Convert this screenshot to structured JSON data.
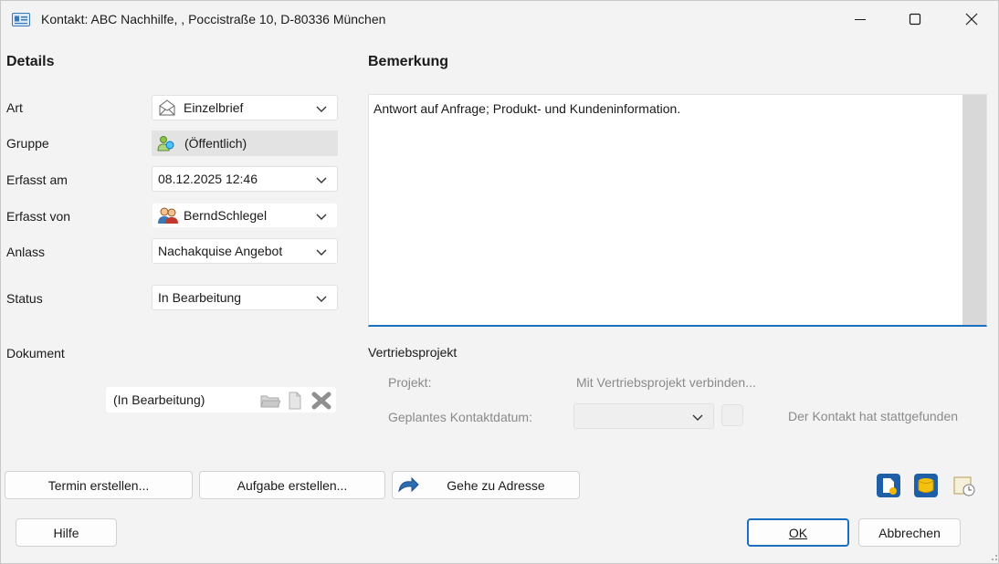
{
  "window": {
    "title": "Kontakt: ABC Nachhilfe,  , Poccistraße 10, D-80336 München",
    "minimize_glyph": "—",
    "close_glyph": "✕"
  },
  "details": {
    "heading": "Details",
    "fields": {
      "art": {
        "label": "Art",
        "value": "Einzelbrief",
        "icon": "envelope-icon"
      },
      "gruppe": {
        "label": "Gruppe",
        "value": "(Öffentlich)",
        "icon": "public-group-icon"
      },
      "erfasst_am": {
        "label": "Erfasst am",
        "value": "08.12.2025 12:46"
      },
      "erfasst_von": {
        "label": "Erfasst von",
        "value": "BerndSchlegel",
        "icon": "users-icon"
      },
      "anlass": {
        "label": "Anlass",
        "value": "Nachakquise Angebot"
      },
      "status": {
        "label": "Status",
        "value": "In Bearbeitung"
      }
    },
    "dokument": {
      "label": "Dokument",
      "value": "(In Bearbeitung)"
    }
  },
  "bemerkung": {
    "heading": "Bemerkung",
    "text": "Antwort auf Anfrage; Produkt- und Kundeninformation."
  },
  "vertriebsprojekt": {
    "heading": "Vertriebsprojekt",
    "projekt_label": "Projekt:",
    "projekt_link": "Mit Vertriebsprojekt verbinden...",
    "kontaktdatum_label": "Geplantes Kontaktdatum:",
    "kontaktdatum_value": "",
    "stattgefunden_label": "Der Kontakt hat stattgefunden"
  },
  "buttons": {
    "termin": "Termin erstellen...",
    "aufgabe": "Aufgabe erstellen...",
    "gehe_zu": "Gehe zu Adresse",
    "hilfe": "Hilfe",
    "ok": "OK",
    "abbrechen": "Abbrechen"
  },
  "colors": {
    "accent": "#1a6fc0",
    "window_bg": "#f3f3f3",
    "disabled_text": "#8a8a8a"
  }
}
